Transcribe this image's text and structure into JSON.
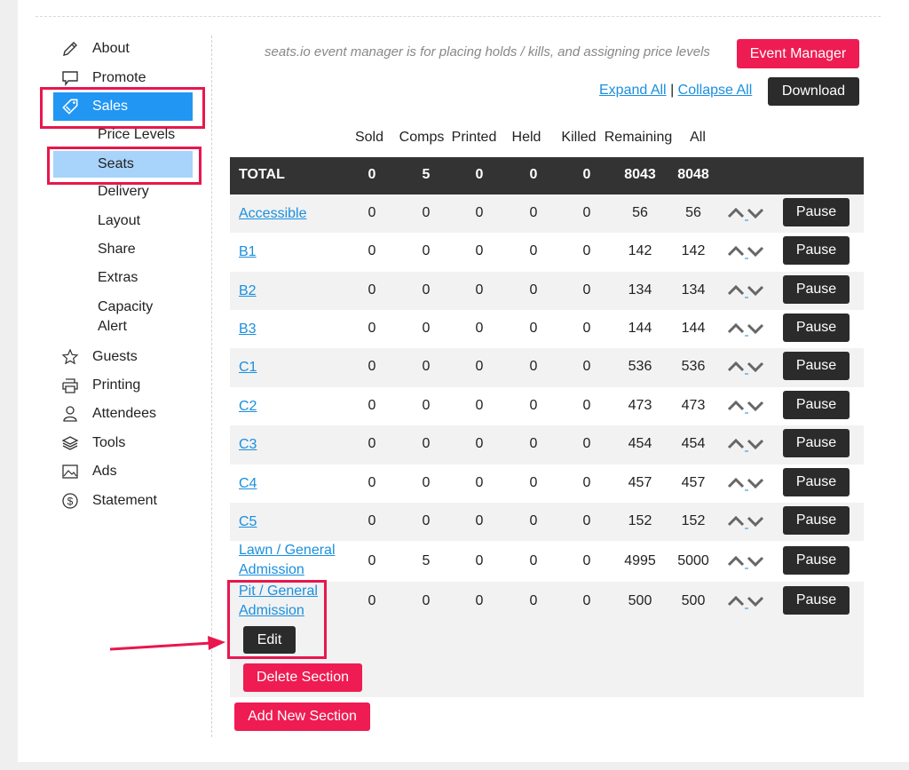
{
  "sidebar": {
    "items": [
      {
        "label": "About",
        "icon": "pencil-icon"
      },
      {
        "label": "Promote",
        "icon": "speech-bubble-icon"
      },
      {
        "label": "Sales",
        "icon": "ticket-icon"
      },
      {
        "label": "Guests",
        "icon": "star-icon"
      },
      {
        "label": "Printing",
        "icon": "printer-icon"
      },
      {
        "label": "Attendees",
        "icon": "person-icon"
      },
      {
        "label": "Tools",
        "icon": "layers-icon"
      },
      {
        "label": "Ads",
        "icon": "image-icon"
      },
      {
        "label": "Statement",
        "icon": "dollar-circle-icon"
      }
    ],
    "sales_sub": [
      "Price Levels",
      "Seats",
      "Delivery",
      "Layout",
      "Share",
      "Extras",
      "Capacity",
      "Alert"
    ]
  },
  "header": {
    "notice": "seats.io event manager is for placing holds / kills, and assigning price levels",
    "event_manager_label": "Event Manager",
    "expand_all": "Expand All",
    "separator": "|",
    "collapse_all": "Collapse All",
    "download_label": "Download"
  },
  "table": {
    "columns": [
      "Sold",
      "Comps",
      "Printed",
      "Held",
      "Killed",
      "Remaining",
      "All"
    ],
    "total": {
      "label": "TOTAL",
      "values": [
        "0",
        "5",
        "0",
        "0",
        "0",
        "8043",
        "8048"
      ]
    },
    "rows": [
      {
        "name": "Accessible",
        "values": [
          "0",
          "0",
          "0",
          "0",
          "0",
          "56",
          "56"
        ]
      },
      {
        "name": "B1",
        "values": [
          "0",
          "0",
          "0",
          "0",
          "0",
          "142",
          "142"
        ]
      },
      {
        "name": "B2",
        "values": [
          "0",
          "0",
          "0",
          "0",
          "0",
          "134",
          "134"
        ]
      },
      {
        "name": "B3",
        "values": [
          "0",
          "0",
          "0",
          "0",
          "0",
          "144",
          "144"
        ]
      },
      {
        "name": "C1",
        "values": [
          "0",
          "0",
          "0",
          "0",
          "0",
          "536",
          "536"
        ]
      },
      {
        "name": "C2",
        "values": [
          "0",
          "0",
          "0",
          "0",
          "0",
          "473",
          "473"
        ]
      },
      {
        "name": "C3",
        "values": [
          "0",
          "0",
          "0",
          "0",
          "0",
          "454",
          "454"
        ]
      },
      {
        "name": "C4",
        "values": [
          "0",
          "0",
          "0",
          "0",
          "0",
          "457",
          "457"
        ]
      },
      {
        "name": "C5",
        "values": [
          "0",
          "0",
          "0",
          "0",
          "0",
          "152",
          "152"
        ]
      },
      {
        "name_line1": "Lawn / General",
        "name_line2": "Admission",
        "values": [
          "0",
          "5",
          "0",
          "0",
          "0",
          "4995",
          "5000"
        ]
      },
      {
        "name_line1": "Pit / General",
        "name_line2": "Admission",
        "values": [
          "0",
          "0",
          "0",
          "0",
          "0",
          "500",
          "500"
        ]
      }
    ],
    "pause_label": "Pause",
    "edit_label": "Edit",
    "delete_section_label": "Delete Section",
    "add_section_label": "Add New Section"
  },
  "colors": {
    "accent": "#ee1c52",
    "blue": "#2196f3",
    "highlight": "#e8174e",
    "dark": "#2b2b2b"
  }
}
